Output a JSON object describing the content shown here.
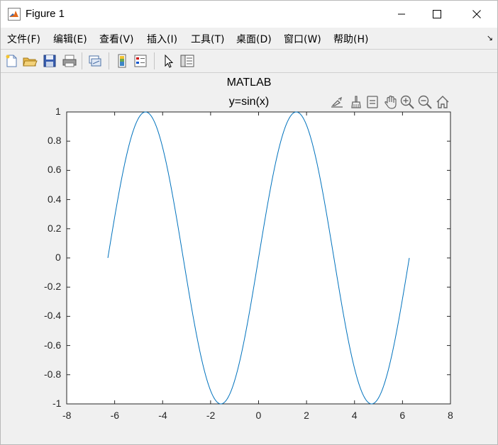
{
  "window": {
    "title": "Figure 1",
    "controls": {
      "minimize": "minimize",
      "maximize": "maximize",
      "close": "close"
    }
  },
  "menu": {
    "items": [
      "文件(F)",
      "编辑(E)",
      "查看(V)",
      "插入(I)",
      "工具(T)",
      "桌面(D)",
      "窗口(W)",
      "帮助(H)"
    ],
    "dock_glyph": "↘"
  },
  "toolbar": {
    "buttons": [
      "new-figure-icon",
      "open-file-icon",
      "save-icon",
      "print-icon",
      "link-plot-icon",
      "colorbar-icon",
      "legend-icon",
      "edit-plot-arrow-icon",
      "property-inspector-icon"
    ]
  },
  "axes_toolbar": {
    "buttons": [
      "export-icon",
      "brush-icon",
      "data-tips-icon",
      "pan-icon",
      "zoom-in-icon",
      "zoom-out-icon",
      "restore-view-icon"
    ]
  },
  "figure": {
    "title": "MATLAB",
    "subtitle": "y=sin(x)"
  },
  "colors": {
    "line": "#0072bd",
    "axes_bg": "#ffffff",
    "figure_bg": "#f0f0f0"
  },
  "chart_data": {
    "type": "line",
    "title": "MATLAB",
    "subtitle": "y=sin(x)",
    "xlabel": "",
    "ylabel": "",
    "xlim": [
      -8,
      8
    ],
    "ylim": [
      -1,
      1
    ],
    "xticks": [
      "-8",
      "-6",
      "-4",
      "-2",
      "0",
      "2",
      "4",
      "6",
      "8"
    ],
    "yticks": [
      "1",
      "0.8",
      "0.6",
      "0.4",
      "0.2",
      "0",
      "-0.2",
      "-0.4",
      "-0.6",
      "-0.8",
      "-1"
    ],
    "grid": false,
    "series": [
      {
        "function": "sin(x)",
        "x_start": -6.2832,
        "x_end": 6.2832,
        "x": [
          -6.28,
          -5.5,
          -4.71,
          -3.93,
          -3.14,
          -2.36,
          -1.57,
          -0.79,
          0,
          0.79,
          1.57,
          2.36,
          3.14,
          3.93,
          4.71,
          5.5,
          6.2
        ],
        "y": [
          0,
          0.71,
          1,
          0.71,
          0,
          -0.71,
          -1,
          -0.71,
          0,
          0.71,
          1,
          0.71,
          0,
          -0.71,
          -1,
          -0.71,
          -0.08
        ]
      }
    ]
  }
}
